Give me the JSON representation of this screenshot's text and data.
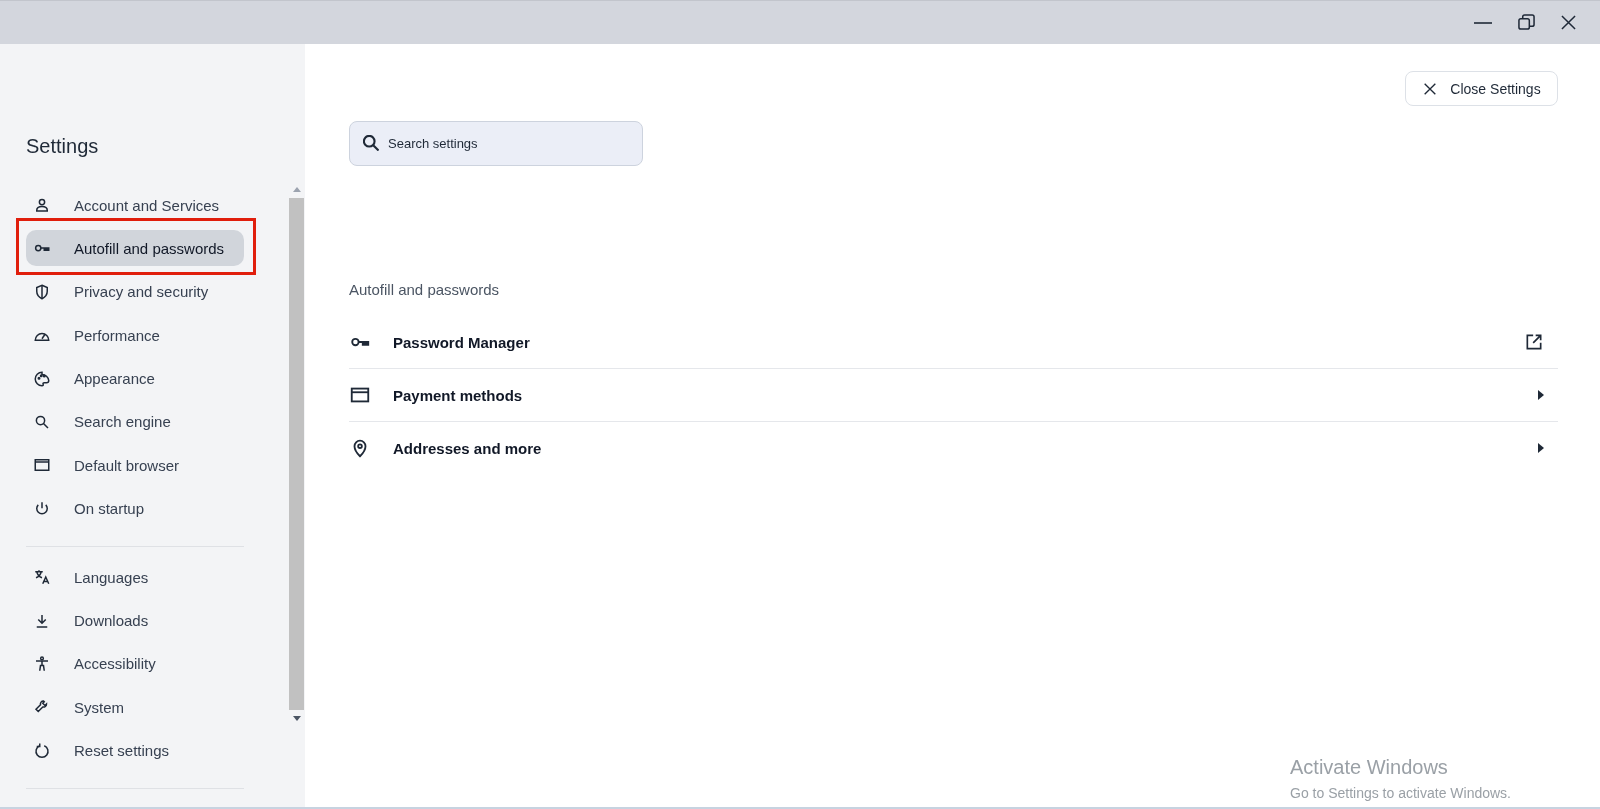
{
  "sidebar": {
    "title": "Settings",
    "groups": [
      [
        {
          "label": "Account and Services",
          "selected": false
        },
        {
          "label": "Autofill and passwords",
          "selected": true
        },
        {
          "label": "Privacy and security",
          "selected": false
        },
        {
          "label": "Performance",
          "selected": false
        },
        {
          "label": "Appearance",
          "selected": false
        },
        {
          "label": "Search engine",
          "selected": false
        },
        {
          "label": "Default browser",
          "selected": false
        },
        {
          "label": "On startup",
          "selected": false
        }
      ],
      [
        {
          "label": "Languages",
          "selected": false
        },
        {
          "label": "Downloads",
          "selected": false
        },
        {
          "label": "Accessibility",
          "selected": false
        },
        {
          "label": "System",
          "selected": false
        },
        {
          "label": "Reset settings",
          "selected": false
        }
      ]
    ]
  },
  "close_button": {
    "label": "Close Settings"
  },
  "search": {
    "placeholder": "Search settings"
  },
  "section": {
    "heading": "Autofill and passwords",
    "rows": [
      {
        "label": "Password Manager",
        "kind": "external"
      },
      {
        "label": "Payment methods",
        "kind": "submenu"
      },
      {
        "label": "Addresses and more",
        "kind": "submenu"
      }
    ]
  },
  "activation_notice": {
    "title": "Activate Windows",
    "text": "Go to Settings to activate Windows."
  }
}
